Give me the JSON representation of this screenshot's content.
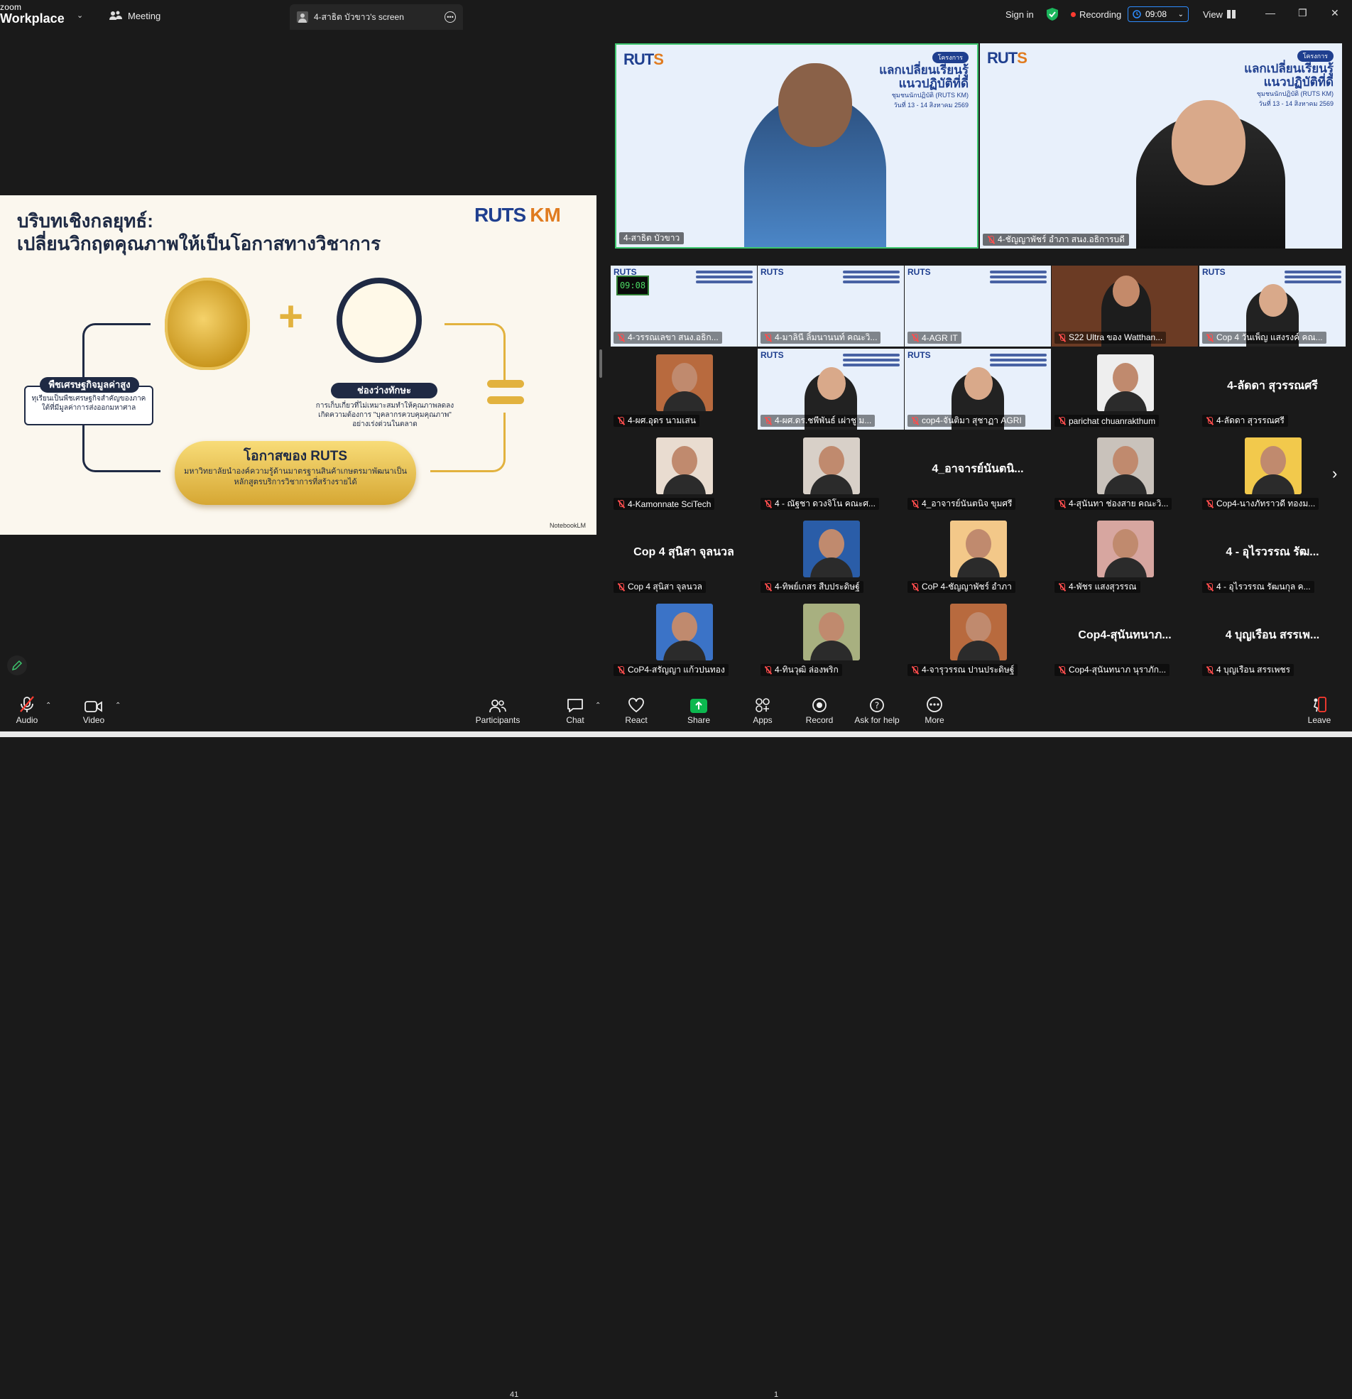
{
  "app": {
    "logo_top": "zoom",
    "logo_bottom": "Workplace"
  },
  "topbar": {
    "meeting_label": "Meeting",
    "screen_tab": "4-สาธิต บัวขาว's screen",
    "sign_in": "Sign in",
    "recording": "Recording",
    "timer": "09:08",
    "view": "View"
  },
  "slide": {
    "title_line1": "บริบทเชิงกลยุทธ์:",
    "title_line2": "เปลี่ยนวิกฤตคุณภาพให้เป็นโอกาสทางวิชาการ",
    "logo_a": "RUTS",
    "logo_b": "KM",
    "left_pill": "พืชเศรษฐกิจมูลค่าสูง",
    "left_text": "ทุเรียนเป็นพืชเศรษฐกิจสำคัญของภาคใต้ที่มีมูลค่าการส่งออกมหาศาล",
    "mid_pill": "ช่องว่างทักษะ",
    "mid_text": "การเก็บเกี่ยวที่ไม่เหมาะสมทำให้คุณภาพลดลง เกิดความต้องการ \"บุคลากรควบคุมคุณภาพ\" อย่างเร่งด่วนในตลาด",
    "gold_title": "โอกาสของ RUTS",
    "gold_text": "มหาวิทยาลัยนำองค์ความรู้ด้านมาตรฐานสินค้าเกษตรมาพัฒนาเป็นหลักสูตรบริการวิชาการที่สร้างรายได้",
    "footer": "NotebookLM"
  },
  "banner": {
    "pill": "โครงการ",
    "line1": "แลกเปลี่ยนเรียนรู้",
    "line2": "แนวปฏิบัติที่ดี",
    "sub": "ชุมชนนักปฏิบัติ (RUTS KM)",
    "date": "วันที่ 13 - 14 สิงหาคม 2569"
  },
  "big_tiles": [
    {
      "name": "4-สาธิต บัวขาว",
      "muted": false
    },
    {
      "name": "4-ชัญญาพัชร์ อำภา สนง.อธิการบดี",
      "muted": true
    }
  ],
  "grid_timer": "09:08",
  "grid": [
    {
      "name": "4-วรรณเลขา  สนง.อธิก...",
      "kind": "blue"
    },
    {
      "name": "4-มาลินี ลิ้มนานนท์ คณะวิ...",
      "kind": "blue"
    },
    {
      "name": "4-AGR IT",
      "kind": "blue"
    },
    {
      "name": "S22 Ultra ของ Watthan...",
      "kind": "room"
    },
    {
      "name": "Cop 4 วันเพ็ญ แสงรงค์ คณ...",
      "kind": "bluep"
    },
    {
      "name": "4-ผศ.อุดร นามเสน",
      "kind": "photo"
    },
    {
      "name": "4-ผศ.ดร.ชพีพันธ์ เผ่าชู ม...",
      "kind": "bluep"
    },
    {
      "name": "cop4-จันติมา สุชาฏา AGRI",
      "kind": "bluep"
    },
    {
      "name": "parichat chuanrakthum",
      "kind": "photo"
    },
    {
      "name": "4-ลัดดา สุวรรณศรี",
      "kind": "text",
      "big": "4-ลัดดา สุวรรณศรี"
    },
    {
      "name": "4-Kamonnate SciTech",
      "kind": "photo"
    },
    {
      "name": "4 - ณัฐชา ดวงจิโน คณะศ...",
      "kind": "photo"
    },
    {
      "name": "4_อาจารย์นันตนิจ ขุมศรี",
      "kind": "text",
      "big": "4_อาจารย์นันตนิ..."
    },
    {
      "name": "4-สุนันทา ช่องสาย คณะวิ...",
      "kind": "photo"
    },
    {
      "name": "Cop4-นางภัทราวดี  ทองม...",
      "kind": "photo"
    },
    {
      "name": "Cop 4 สุนิสา จุลนวล",
      "kind": "text",
      "big": "Cop 4 สุนิสา จุลนวล"
    },
    {
      "name": "4-ทิพย์เกสร สืบประดิษฐ์",
      "kind": "photo"
    },
    {
      "name": "CoP 4-ชัญญาพัชร์ อำภา",
      "kind": "photo"
    },
    {
      "name": "4-พัชร แสงสุวรรณ",
      "kind": "photo"
    },
    {
      "name": "4 - อุไรวรรณ รัฒนกุล ค...",
      "kind": "text",
      "big": "4 - อุไรวรรณ รัฒ..."
    },
    {
      "name": "CoP4-สรัญญา แก้วปนทอง",
      "kind": "photo"
    },
    {
      "name": "4-ทินวุฒิ ล่องพริก",
      "kind": "photo"
    },
    {
      "name": "4-จารุวรรณ ปานประดิษฐ์",
      "kind": "photo"
    },
    {
      "name": "Cop4-สุนันทนาภ นุราภัก...",
      "kind": "text",
      "big": "Cop4-สุนันทนาภ..."
    },
    {
      "name": "4 บุญเรือน สรรเพชร",
      "kind": "text",
      "big": "4 บุญเรือน สรรเพ..."
    }
  ],
  "toolbar": {
    "audio": "Audio",
    "video": "Video",
    "participants": "Participants",
    "participants_count": "41",
    "chat": "Chat",
    "react": "React",
    "share": "Share",
    "apps": "Apps",
    "apps_count": "1",
    "record": "Record",
    "help": "Ask for help",
    "more": "More",
    "leave": "Leave"
  },
  "colors": {
    "accent": "#2d8cff",
    "share": "#0cb84f",
    "muted": "#ff4d4d",
    "rec": "#ff3b30",
    "brand_blue": "#1f3f8f",
    "brand_orange": "#e07b1f"
  }
}
